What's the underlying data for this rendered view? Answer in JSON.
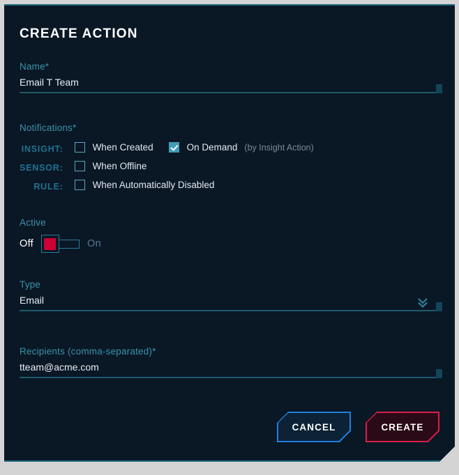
{
  "dialog": {
    "title": "CREATE ACTION"
  },
  "name_field": {
    "label": "Name*",
    "value": "Email T Team",
    "placeholder": ""
  },
  "notifications": {
    "label": "Notifications*",
    "rows": [
      {
        "row_label": "INSIGHT:",
        "options": [
          {
            "label": "When Created",
            "checked": false,
            "note": ""
          },
          {
            "label": "On Demand",
            "checked": true,
            "note": "(by Insight Action)"
          }
        ]
      },
      {
        "row_label": "SENSOR:",
        "options": [
          {
            "label": "When Offline",
            "checked": false,
            "note": ""
          }
        ]
      },
      {
        "row_label": "RULE:",
        "options": [
          {
            "label": "When Automatically Disabled",
            "checked": false,
            "note": ""
          }
        ]
      }
    ]
  },
  "active": {
    "label": "Active",
    "off_label": "Off",
    "on_label": "On",
    "state": "Off",
    "knob_color": "#cc0033"
  },
  "type_field": {
    "label": "Type",
    "value": "Email",
    "icon": "chevron-double-down-icon"
  },
  "recipients_field": {
    "label": "Recipients (comma-separated)*",
    "value": "tteam@acme.com",
    "placeholder": ""
  },
  "buttons": {
    "cancel_label": "CANCEL",
    "create_label": "CREATE",
    "cancel_color": "#1f7fe0",
    "create_color": "#d61f4a"
  },
  "colors": {
    "background": "#0a1725",
    "accent_teal": "#3a92ab",
    "border_teal": "#1f6b7d",
    "page_surround": "#d4d4d4"
  }
}
